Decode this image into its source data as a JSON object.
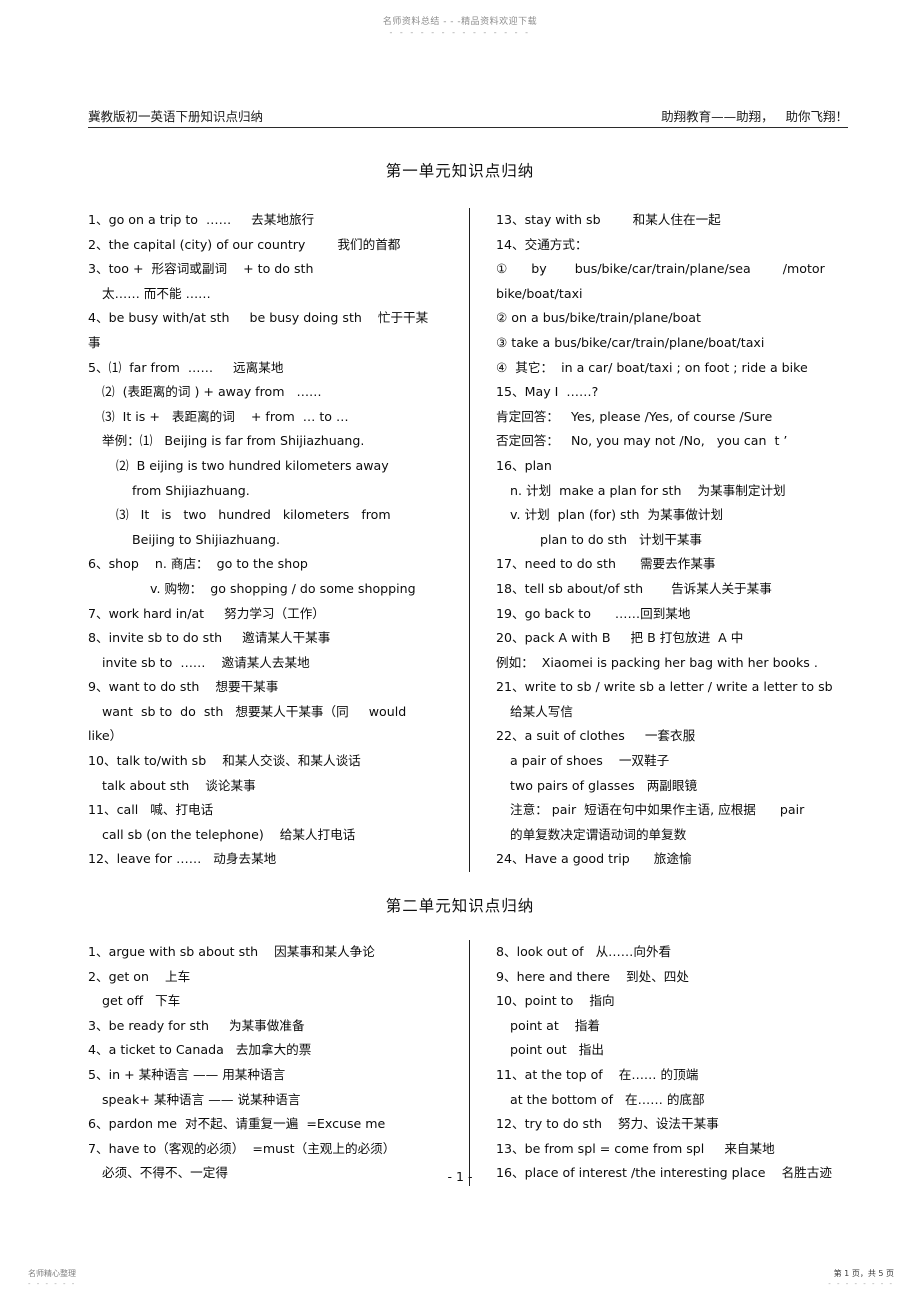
{
  "watermark": {
    "top_text": "名师资料总结 - - -精品资料欢迎下载",
    "top_dashes": "- - - - - - - - - - - - - -",
    "footer_left": "名师精心整理",
    "footer_left_dashes": "- - - - - -",
    "footer_right": "第 1 页，共 5 页",
    "footer_right_dashes": "- - - - - - - -"
  },
  "header": {
    "left": "冀教版初一英语下册知识点归纳",
    "right": "助翔教育——助翔，   助你飞翔！"
  },
  "page_number": "- 1 -",
  "unit1": {
    "title": "第一单元知识点归纳",
    "left_lines": [
      {
        "indent": 0,
        "text": "1、go on a trip to  ……     去某地旅行"
      },
      {
        "indent": 0,
        "text": "2、the capital (city) of our country        我们的首都"
      },
      {
        "indent": 0,
        "text": "3、too +  形容词或副词    + to do sth"
      },
      {
        "indent": 1,
        "text": "太…… 而不能 ……"
      },
      {
        "indent": 0,
        "text": "4、be busy with/at sth     be busy doing sth    忙于干某"
      },
      {
        "indent": 0,
        "text": "事"
      },
      {
        "indent": 0,
        "text": "5、⑴  far from  ……     远离某地"
      },
      {
        "indent": 1,
        "text": "⑵  (表距离的词 ) + away from   ……"
      },
      {
        "indent": 1,
        "text": "⑶  It is +   表距离的词    + from  … to …"
      },
      {
        "indent": 1,
        "text": "举例：⑴   Beijing is far from Shijiazhuang."
      },
      {
        "indent": 2,
        "text": "⑵  B eijing is two hundred kilometers away"
      },
      {
        "indent": 3,
        "text": "from Shijiazhuang."
      },
      {
        "indent": 2,
        "text": "⑶   It   is   two   hundred   kilometers   from"
      },
      {
        "indent": 3,
        "text": "Beijing to Shijiazhuang."
      },
      {
        "indent": 0,
        "text": "6、shop    n. 商店：  go to the shop"
      },
      {
        "indent": 4,
        "text": "v. 购物：  go shopping / do some shopping"
      },
      {
        "indent": 0,
        "text": "7、work hard in/at     努力学习（工作）"
      },
      {
        "indent": 0,
        "text": "8、invite sb to do sth     邀请某人干某事"
      },
      {
        "indent": 1,
        "text": "invite sb to  ……    邀请某人去某地"
      },
      {
        "indent": 0,
        "text": "9、want to do sth    想要干某事"
      },
      {
        "indent": 1,
        "text": "want  sb to  do  sth   想要某人干某事（同     would"
      },
      {
        "indent": 0,
        "text": "like）"
      },
      {
        "indent": 0,
        "text": "10、talk to/with sb    和某人交谈、和某人谈话"
      },
      {
        "indent": 1,
        "text": "talk about sth    谈论某事"
      },
      {
        "indent": 0,
        "text": "11、call   喊、打电话"
      },
      {
        "indent": 1,
        "text": "call sb (on the telephone)    给某人打电话"
      },
      {
        "indent": 0,
        "text": "12、leave for ……   动身去某地"
      }
    ],
    "right_lines": [
      {
        "indent": 0,
        "text": "13、stay with sb        和某人住在一起"
      },
      {
        "indent": 0,
        "text": "14、交通方式："
      },
      {
        "indent": 0,
        "text": "①      by       bus/bike/car/train/plane/sea        /motor"
      },
      {
        "indent": 0,
        "text": "bike/boat/taxi"
      },
      {
        "indent": 0,
        "text": "② on a bus/bike/train/plane/boat"
      },
      {
        "indent": 0,
        "text": "③ take a bus/bike/car/train/plane/boat/taxi"
      },
      {
        "indent": 0,
        "text": "④  其它：  in a car/ boat/taxi ; on foot ; ride a bike"
      },
      {
        "indent": 0,
        "text": "15、May I  ……?"
      },
      {
        "indent": 0,
        "text": "肯定回答：   Yes, please /Yes, of course /Sure"
      },
      {
        "indent": 0,
        "text": "否定回答：   No, you may not /No,   you can  t ’"
      },
      {
        "indent": 0,
        "text": "16、plan"
      },
      {
        "indent": 1,
        "text": "n. 计划  make a plan for sth    为某事制定计划"
      },
      {
        "indent": 1,
        "text": "v. 计划  plan (for) sth  为某事做计划"
      },
      {
        "indent": 3,
        "text": "plan to do sth   计划干某事"
      },
      {
        "indent": 0,
        "text": "17、need to do sth      需要去作某事"
      },
      {
        "indent": 0,
        "text": "18、tell sb about/of sth       告诉某人关于某事"
      },
      {
        "indent": 0,
        "text": "19、go back to      ……回到某地"
      },
      {
        "indent": 0,
        "text": "20、pack A with B     把 B 打包放进  A 中"
      },
      {
        "indent": 0,
        "text": "例如：  Xiaomei is packing her bag with her books ."
      },
      {
        "indent": 0,
        "text": "21、write to sb / write sb a letter / write a letter to sb"
      },
      {
        "indent": 1,
        "text": "给某人写信"
      },
      {
        "indent": 0,
        "text": "22、a suit of clothes     一套衣服"
      },
      {
        "indent": 1,
        "text": "a pair of shoes    一双鞋子"
      },
      {
        "indent": 1,
        "text": "two pairs of glasses   两副眼镜"
      },
      {
        "indent": 1,
        "text": "注意： pair  短语在句中如果作主语, 应根据      pair"
      },
      {
        "indent": 1,
        "text": "的单复数决定谓语动词的单复数"
      },
      {
        "indent": 0,
        "text": "24、Have a good trip      旅途愉"
      }
    ]
  },
  "unit2": {
    "title": "第二单元知识点归纳",
    "left_lines": [
      {
        "indent": 0,
        "text": "1、argue with sb about sth    因某事和某人争论"
      },
      {
        "indent": 0,
        "text": "2、get on    上车"
      },
      {
        "indent": 1,
        "text": "get off   下车"
      },
      {
        "indent": 0,
        "text": "3、be ready for sth     为某事做准备"
      },
      {
        "indent": 0,
        "text": "4、a ticket to Canada   去加拿大的票"
      },
      {
        "indent": 0,
        "text": "5、in + 某种语言 —— 用某种语言"
      },
      {
        "indent": 1,
        "text": "speak+ 某种语言 —— 说某种语言"
      },
      {
        "indent": 0,
        "text": "6、pardon me  对不起、请重复一遍  =Excuse me"
      },
      {
        "indent": 0,
        "text": "7、have to（客观的必须）  =must（主观上的必须）"
      },
      {
        "indent": 1,
        "text": "必须、不得不、一定得"
      }
    ],
    "right_lines": [
      {
        "indent": 0,
        "text": "8、look out of   从……向外看"
      },
      {
        "indent": 0,
        "text": "9、here and there    到处、四处"
      },
      {
        "indent": 0,
        "text": "10、point to    指向"
      },
      {
        "indent": 1,
        "text": "point at    指着"
      },
      {
        "indent": 1,
        "text": "point out   指出"
      },
      {
        "indent": 0,
        "text": "11、at the top of    在…… 的顶端"
      },
      {
        "indent": 1,
        "text": "at the bottom of   在…… 的底部"
      },
      {
        "indent": 0,
        "text": "12、try to do sth    努力、设法干某事"
      },
      {
        "indent": 0,
        "text": "13、be from spl = come from spl     来自某地"
      },
      {
        "indent": 0,
        "text": "16、place of interest /the interesting place    名胜古迹"
      }
    ]
  }
}
